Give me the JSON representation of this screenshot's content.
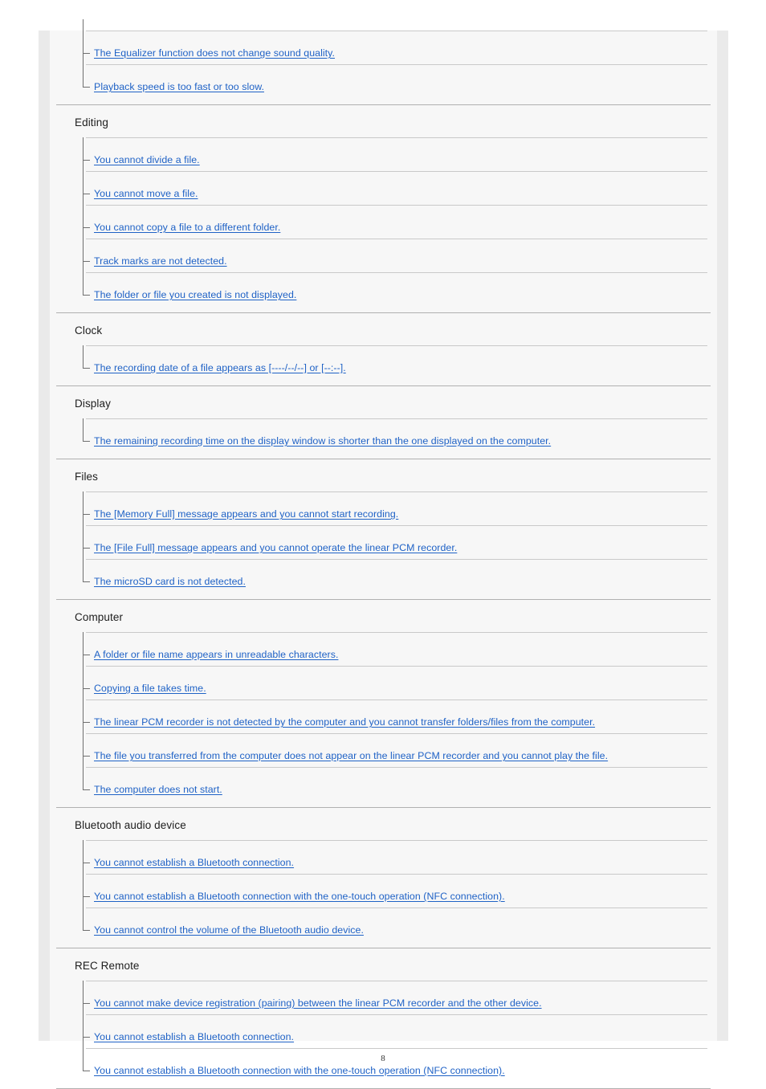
{
  "document": {
    "page_number": "8",
    "link_color": "#1f62c6",
    "heading_color": "#1d1d1d",
    "page_background": "#f7f7f7"
  },
  "sections": [
    {
      "heading": "",
      "continued_from_previous_page": true,
      "items": [
        {
          "label": "The Equalizer function does not change sound quality."
        },
        {
          "label": "Playback speed is too fast or too slow."
        }
      ]
    },
    {
      "heading": "Editing",
      "continued_from_previous_page": false,
      "items": [
        {
          "label": "You cannot divide a file."
        },
        {
          "label": "You cannot move a file."
        },
        {
          "label": "You cannot copy a file to a different folder."
        },
        {
          "label": "Track marks are not detected."
        },
        {
          "label": "The folder or file you created is not displayed."
        }
      ]
    },
    {
      "heading": "Clock",
      "continued_from_previous_page": false,
      "items": [
        {
          "label": "The recording date of a file appears as [----/--/--] or [--:--]."
        }
      ]
    },
    {
      "heading": "Display",
      "continued_from_previous_page": false,
      "items": [
        {
          "label": "The remaining recording time on the display window is shorter than the one displayed on the computer."
        }
      ]
    },
    {
      "heading": "Files",
      "continued_from_previous_page": false,
      "items": [
        {
          "label": "The [Memory Full] message appears and you cannot start recording."
        },
        {
          "label": "The [File Full] message appears and you cannot operate the linear PCM recorder."
        },
        {
          "label": "The microSD card is not detected."
        }
      ]
    },
    {
      "heading": "Computer",
      "continued_from_previous_page": false,
      "items": [
        {
          "label": "A folder or file name appears in unreadable characters."
        },
        {
          "label": "Copying a file takes time."
        },
        {
          "label": "The linear PCM recorder is not detected by the computer and you cannot transfer folders/files from the computer."
        },
        {
          "label": "The file you transferred from the computer does not appear on the linear PCM recorder and you cannot play the file."
        },
        {
          "label": "The computer does not start."
        }
      ]
    },
    {
      "heading": "Bluetooth audio device",
      "continued_from_previous_page": false,
      "items": [
        {
          "label": "You cannot establish a Bluetooth connection."
        },
        {
          "label": "You cannot establish a Bluetooth connection with the one-touch operation (NFC connection)."
        },
        {
          "label": "You cannot control the volume of the Bluetooth audio device."
        }
      ]
    },
    {
      "heading": "REC Remote",
      "continued_from_previous_page": false,
      "items": [
        {
          "label": "You cannot make device registration (pairing) between the linear PCM recorder and the other device."
        },
        {
          "label": "You cannot establish a Bluetooth connection."
        },
        {
          "label": "You cannot establish a Bluetooth connection with the one-touch operation (NFC connection)."
        }
      ]
    }
  ]
}
